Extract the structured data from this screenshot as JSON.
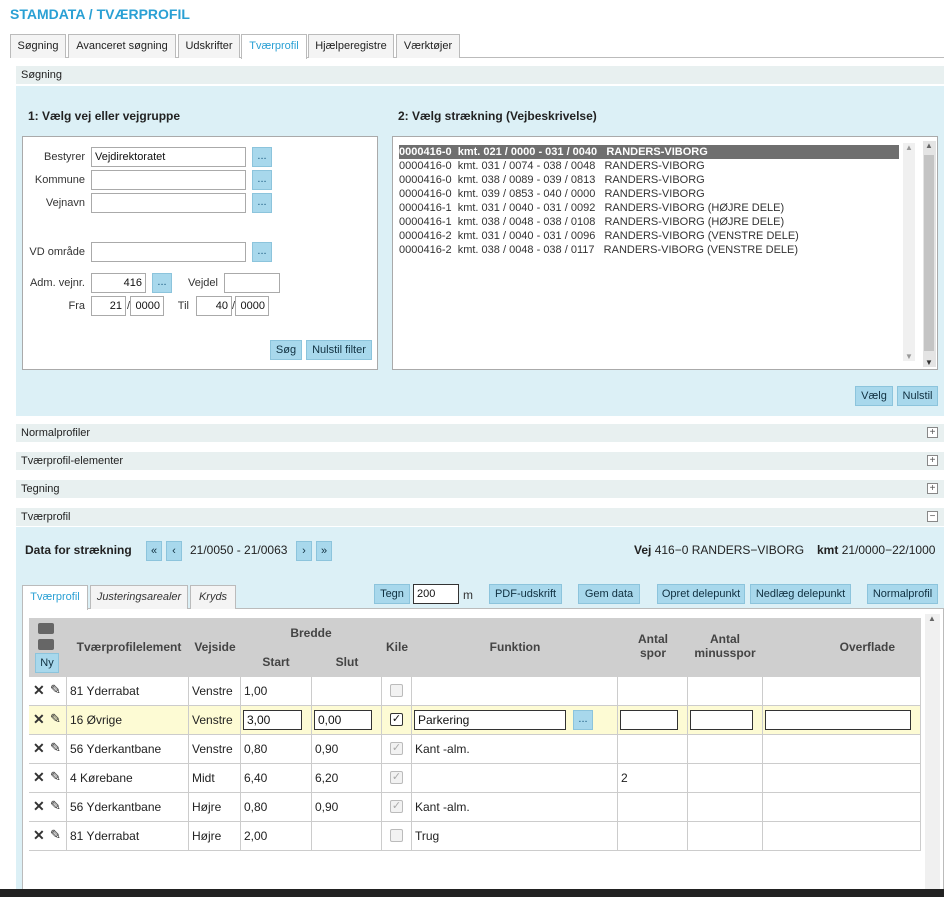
{
  "app_title": "STAMDATA / TVÆRPROFIL",
  "tabs": [
    "Søgning",
    "Avanceret søgning",
    "Udskrifter",
    "Tværprofil",
    "Hjælperegistre",
    "Værktøjer"
  ],
  "search_panel": {
    "title": "Søgning",
    "step1_title": "1: Vælg vej eller vejgruppe",
    "step2_title": "2: Vælg strækning (Vejbeskrivelse)",
    "bestyrer_label": "Bestyrer",
    "bestyrer_value": "Vejdirektoratet",
    "kommune_label": "Kommune",
    "kommune_value": "",
    "vejnavn_label": "Vejnavn",
    "vejnavn_value": "",
    "vd_label": "VD område",
    "vd_value": "",
    "adm_label": "Adm. vejnr.",
    "adm_value": "416",
    "vejdel_label": "Vejdel",
    "vejdel_value": "",
    "fra_label": "Fra",
    "fra_km": "21",
    "fra_m": "0000",
    "til_label": "Til",
    "til_km": "40",
    "til_m": "0000",
    "slash": "/",
    "dots": "...",
    "sog_btn": "Søg",
    "nulstil_filter_btn": "Nulstil filter",
    "vaelg_btn": "Vælg",
    "nulstil_btn": "Nulstil",
    "list": [
      "0000416-0  kmt. 021 / 0000 - 031 / 0040   RANDERS-VIBORG",
      "0000416-0  kmt. 031 / 0074 - 038 / 0048   RANDERS-VIBORG",
      "0000416-0  kmt. 038 / 0089 - 039 / 0813   RANDERS-VIBORG",
      "0000416-0  kmt. 039 / 0853 - 040 / 0000   RANDERS-VIBORG",
      "0000416-1  kmt. 031 / 0040 - 031 / 0092   RANDERS-VIBORG (HØJRE DELE)",
      "0000416-1  kmt. 038 / 0048 - 038 / 0108   RANDERS-VIBORG (HØJRE DELE)",
      "0000416-2  kmt. 031 / 0040 - 031 / 0096   RANDERS-VIBORG (VENSTRE DELE)",
      "0000416-2  kmt. 038 / 0048 - 038 / 0117   RANDERS-VIBORG (VENSTRE DELE)"
    ]
  },
  "collapsed_panels": {
    "normal": "Normalprofiler",
    "elements": "Tværprofil-elementer",
    "tegning": "Tegning"
  },
  "plus": "+",
  "minus": "−",
  "tvaer_panel": {
    "title": "Tværprofil",
    "data_label": "Data for strækning",
    "nav_first": "«",
    "nav_prev": "‹",
    "nav_next": "›",
    "nav_last": "»",
    "range": "21/0050 - 21/0063",
    "vej_label": "Vej",
    "vej_value": "416−0 RANDERS−VIBORG",
    "kmt_label": "kmt",
    "kmt_value": "21/0000−22/1000",
    "inner_tabs": [
      "Tværprofil",
      "Justeringsarealer",
      "Kryds"
    ],
    "tegn_btn": "Tegn",
    "scale_value": "200",
    "scale_unit": "m",
    "pdf_btn": "PDF-udskrift",
    "gem_btn": "Gem data",
    "opret_btn": "Opret delepunkt",
    "nedlaeg_btn": "Nedlæg delepunkt",
    "normal_btn": "Normalprofil",
    "ny_btn": "Ny",
    "headers": {
      "element": "Tværprofilelement",
      "vejside": "Vejside",
      "bredde": "Bredde",
      "start": "Start",
      "slut": "Slut",
      "kile": "Kile",
      "funktion": "Funktion",
      "antal_spor": "Antal spor",
      "antal_minus": "Antal minusspor",
      "overflade": "Overflade"
    },
    "rows": [
      {
        "element": "81 Yderrabat",
        "vejside": "Venstre",
        "start": "1,00",
        "slut": "",
        "kile": false,
        "funktion": "",
        "spor": "",
        "minus": "",
        "overflade": ""
      },
      {
        "element": "16 Øvrige",
        "vejside": "Venstre",
        "start": "3,00",
        "slut": "0,00",
        "kile": true,
        "funktion": "Parkering",
        "spor": "",
        "minus": "",
        "overflade": ""
      },
      {
        "element": "56 Yderkantbane",
        "vejside": "Venstre",
        "start": "0,80",
        "slut": "0,90",
        "kile": true,
        "funktion": "Kant -alm.",
        "spor": "",
        "minus": "",
        "overflade": ""
      },
      {
        "element": "4 Kørebane",
        "vejside": "Midt",
        "start": "6,40",
        "slut": "6,20",
        "kile": true,
        "funktion": "",
        "spor": "2",
        "minus": "",
        "overflade": ""
      },
      {
        "element": "56 Yderkantbane",
        "vejside": "Højre",
        "start": "0,80",
        "slut": "0,90",
        "kile": true,
        "funktion": "Kant -alm.",
        "spor": "",
        "minus": "",
        "overflade": ""
      },
      {
        "element": "81 Yderrabat",
        "vejside": "Højre",
        "start": "2,00",
        "slut": "",
        "kile": false,
        "funktion": "Trug",
        "spor": "",
        "minus": "",
        "overflade": ""
      }
    ]
  },
  "icons": {
    "delete": "close-icon",
    "edit": "pencil-icon",
    "camera": "camera-icon"
  },
  "colors": {
    "accent": "#2aa0d4",
    "button": "#a8d8ec",
    "edit_row": "#fdfbd4",
    "selected_list": "#6f6f6f"
  }
}
